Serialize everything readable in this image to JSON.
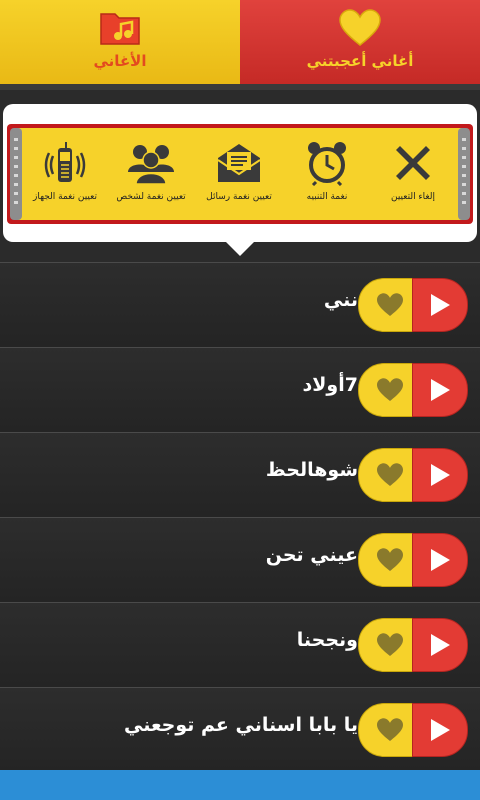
{
  "tabs": {
    "songs_label": "الأغاني",
    "liked_label": "أغاني أعجبتني"
  },
  "popup": {
    "actions": [
      {
        "label": "إلغاء التعيين",
        "icon": "close-x-icon"
      },
      {
        "label": "نغمة التنبيه",
        "icon": "alarm-clock-icon"
      },
      {
        "label": "تعيين نغمة رسائل",
        "icon": "envelope-icon"
      },
      {
        "label": "تعيين نغمة لشخص",
        "icon": "contacts-icon"
      },
      {
        "label": "تعيين نغمة الجهاز",
        "icon": "ringing-phone-icon"
      }
    ]
  },
  "songs": [
    {
      "title": "نني"
    },
    {
      "title": "7أولاد"
    },
    {
      "title": "شوهالحظ"
    },
    {
      "title": "عيني تحن"
    },
    {
      "title": "ونجحنا"
    },
    {
      "title": "يا بابا اسناني عم توجعني"
    }
  ],
  "colors": {
    "yellow": "#f6d22a",
    "red": "#e33b34",
    "dark": "#2b2b2b",
    "blue_bar": "#2c8ed6"
  }
}
